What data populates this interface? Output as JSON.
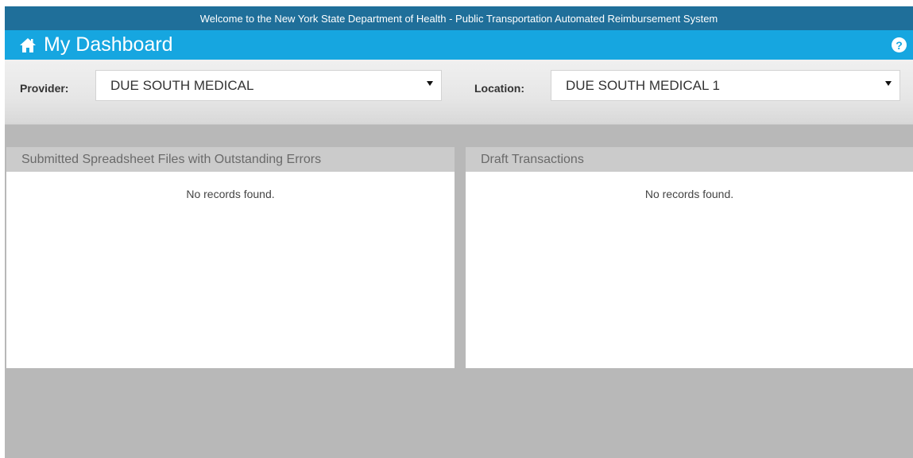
{
  "header": {
    "welcome_text": "Welcome to the New York State Department of Health - Public Transportation Automated Reimbursement System",
    "title": "My Dashboard",
    "help_icon": "question-circle-icon",
    "home_icon": "home-icon"
  },
  "filters": {
    "provider_label": "Provider:",
    "provider_value": "DUE SOUTH MEDICAL",
    "location_label": "Location:",
    "location_value": "DUE SOUTH MEDICAL 1"
  },
  "panels": [
    {
      "title": "Submitted Spreadsheet Files with Outstanding Errors",
      "empty_text": "No records found."
    },
    {
      "title": "Draft Transactions",
      "empty_text": "No records found."
    }
  ],
  "colors": {
    "welcome_bar": "#1f6f9a",
    "title_bar": "#16a6e0",
    "page_background": "#b8b8b8"
  }
}
